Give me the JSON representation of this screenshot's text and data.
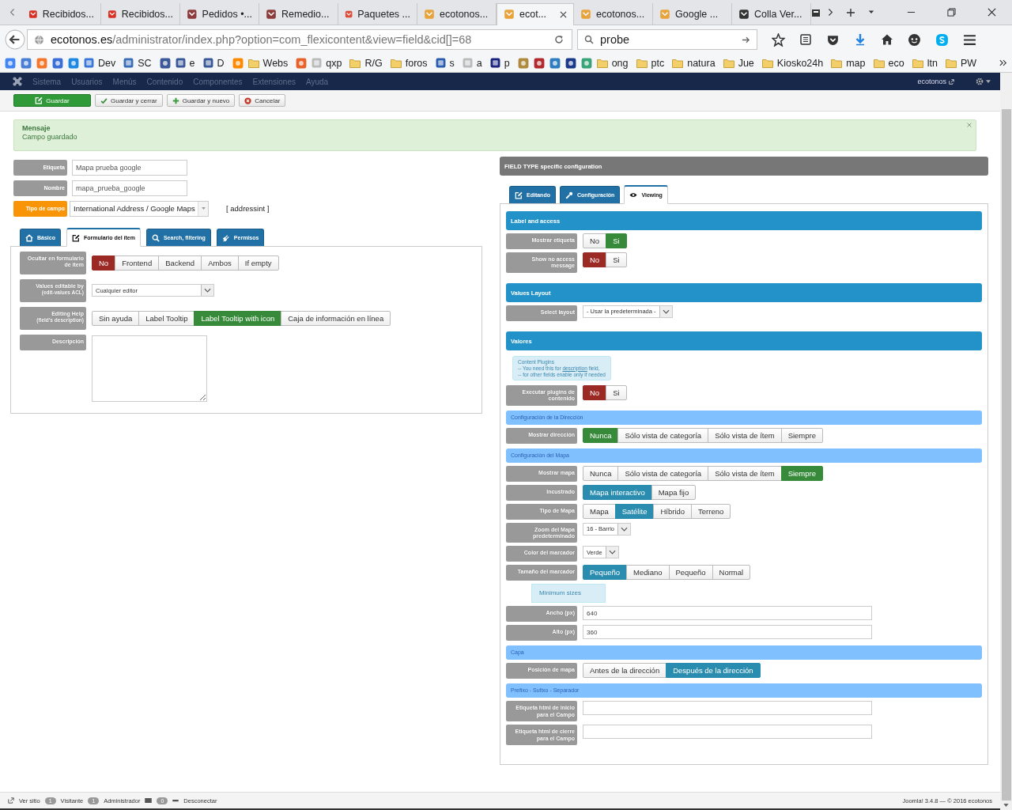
{
  "browser": {
    "tabs": [
      {
        "title": "Recibidos...",
        "selected": false
      },
      {
        "title": "Recibidos...",
        "selected": false
      },
      {
        "title": "Pedidos •...",
        "selected": false
      },
      {
        "title": "Remedio...",
        "selected": false
      },
      {
        "title": "Paquetes ...",
        "selected": false
      },
      {
        "title": "ecotonos...",
        "selected": false
      },
      {
        "title": "ecot...",
        "selected": true
      },
      {
        "title": "ecotonos...",
        "selected": false
      },
      {
        "title": "Google ...",
        "selected": false
      },
      {
        "title": "Colla Ver...",
        "selected": false
      }
    ],
    "url_host": "ecotonos.es",
    "url_path": "/administrator/index.php?option=com_flexicontent&view=field&cid[]=68",
    "search": "probe",
    "bookmarks": [
      {
        "kind": "icon"
      },
      {
        "kind": "icon"
      },
      {
        "kind": "icon"
      },
      {
        "kind": "icon"
      },
      {
        "kind": "icon"
      },
      {
        "kind": "site",
        "label": "Dev"
      },
      {
        "kind": "site",
        "label": "SC"
      },
      {
        "kind": "icon"
      },
      {
        "kind": "site",
        "label": "e"
      },
      {
        "kind": "site",
        "label": "D"
      },
      {
        "kind": "icon"
      },
      {
        "kind": "folder",
        "label": "Webs"
      },
      {
        "kind": "icon"
      },
      {
        "kind": "site",
        "label": "qxp"
      },
      {
        "kind": "folder",
        "label": "R/G"
      },
      {
        "kind": "folder",
        "label": "foros"
      },
      {
        "kind": "site",
        "label": "s"
      },
      {
        "kind": "site",
        "label": "a"
      },
      {
        "kind": "site",
        "label": "p"
      },
      {
        "kind": "icon"
      },
      {
        "kind": "icon"
      },
      {
        "kind": "icon"
      },
      {
        "kind": "icon"
      },
      {
        "kind": "icon"
      },
      {
        "kind": "folder",
        "label": "ong"
      },
      {
        "kind": "folder",
        "label": "ptc"
      },
      {
        "kind": "folder",
        "label": "natura"
      },
      {
        "kind": "folder",
        "label": "Jue"
      },
      {
        "kind": "folder",
        "label": "Kiosko24h"
      },
      {
        "kind": "folder",
        "label": "map"
      },
      {
        "kind": "folder",
        "label": "eco"
      },
      {
        "kind": "folder",
        "label": "ltn"
      },
      {
        "kind": "folder",
        "label": "PW"
      }
    ]
  },
  "admin_menu": {
    "items": [
      "Sistema",
      "Usuarios",
      "Menús",
      "Contenido",
      "Componentes",
      "Extensiones",
      "Ayuda"
    ],
    "user": "ecotonos"
  },
  "toolbar": [
    {
      "label": "Guardar",
      "kind": "primary"
    },
    {
      "label": "Guardar y cerrar",
      "kind": "default"
    },
    {
      "label": "Guardar y nuevo",
      "kind": "default"
    },
    {
      "label": "Cancelar",
      "kind": "default"
    }
  ],
  "message": {
    "title": "Mensaje",
    "text": "Campo guardado"
  },
  "left": {
    "fields": [
      {
        "label": "Etiqueta",
        "kind": "input",
        "value": "Mapa prueba google",
        "highlight": false
      },
      {
        "label": "Nombre",
        "kind": "input",
        "value": "mapa_prueba_google",
        "highlight": false
      },
      {
        "label": "Tipo de campo",
        "kind": "select",
        "value": "International Address / Google Maps",
        "note": "[ addressint ]",
        "highlight": true
      }
    ],
    "tabs": [
      {
        "label": "Básico",
        "selected": false
      },
      {
        "label": "Formulario del ítem",
        "selected": true
      },
      {
        "label": "Search, filtering",
        "selected": false
      },
      {
        "label": "Permisos",
        "selected": false
      }
    ],
    "rows": [
      {
        "label": "Ocultar en formulario de ítem",
        "kind": "toggle",
        "color": "#9b2a25",
        "options": [
          {
            "label": "No",
            "selected": true
          },
          {
            "label": "Frontend",
            "selected": false
          },
          {
            "label": "Backend",
            "selected": false
          },
          {
            "label": "Ambos",
            "selected": false
          },
          {
            "label": "If empty",
            "selected": false
          }
        ]
      },
      {
        "label": "Values editable by",
        "sub": "(edit-values ACL)",
        "kind": "select",
        "value": "Cualquier editor"
      },
      {
        "label": "Editing Help",
        "sub": "(field's description)",
        "kind": "toggle",
        "color": "#378a3a",
        "options": [
          {
            "label": "Sin ayuda",
            "selected": false
          },
          {
            "label": "Label Tooltip",
            "selected": false
          },
          {
            "label": "Label Tooltip with icon",
            "selected": true
          },
          {
            "label": "Caja de información en línea",
            "selected": false
          }
        ]
      },
      {
        "label": "Descripción",
        "kind": "textarea"
      }
    ]
  },
  "right": {
    "title": "FIELD TYPE specific configuration",
    "tabs": [
      {
        "label": "Editando",
        "selected": false
      },
      {
        "label": "Configuración",
        "selected": false
      },
      {
        "label": "Viewing",
        "selected": true
      }
    ],
    "sections": [
      {
        "title": "Label and access",
        "kind": "major",
        "rows": [
          {
            "label": "Mostrar etiqueta",
            "kind": "toggle",
            "color": "#378a3a",
            "options": [
              {
                "label": "No",
                "selected": false
              },
              {
                "label": "Si",
                "selected": true
              }
            ]
          },
          {
            "label": "Show no access message",
            "kind": "toggle",
            "color": "#9b2a25",
            "options": [
              {
                "label": "No",
                "selected": true
              },
              {
                "label": "Si",
                "selected": false
              }
            ]
          }
        ]
      },
      {
        "title": "Values Layout",
        "kind": "major",
        "rows": [
          {
            "label": "Select layout",
            "kind": "select",
            "value": "- Usar la predeterminada -"
          }
        ]
      },
      {
        "title": "Valores",
        "kind": "major",
        "rows": [
          {
            "kind": "plugin_note",
            "title": "Content Plugins",
            "line1": "-- You need this for ",
            "link": "description",
            "line1_end": " field,",
            "line2": "-- for other fields enable only if needed"
          },
          {
            "label": "Executar plugins de contenido",
            "kind": "toggle",
            "color": "#9b2a25",
            "options": [
              {
                "label": "No",
                "selected": true
              },
              {
                "label": "Si",
                "selected": false
              }
            ]
          }
        ]
      },
      {
        "title": "Configuración de la Dirección",
        "kind": "minor",
        "rows": [
          {
            "label": "Mostrar dirección",
            "kind": "toggle",
            "color": "#378a3a",
            "options": [
              {
                "label": "Nunca",
                "selected": true
              },
              {
                "label": "Sólo vista de categoría",
                "selected": false
              },
              {
                "label": "Sólo vista de ítem",
                "selected": false
              },
              {
                "label": "Siempre",
                "selected": false
              }
            ]
          }
        ]
      },
      {
        "title": "Configuración del Mapa",
        "kind": "minor",
        "rows": [
          {
            "label": "Mostrar mapa",
            "kind": "toggle",
            "color": "#378a3a",
            "options": [
              {
                "label": "Nunca",
                "selected": false
              },
              {
                "label": "Sólo vista de categoría",
                "selected": false
              },
              {
                "label": "Sólo vista de ítem",
                "selected": false
              },
              {
                "label": "Siempre",
                "selected": true
              }
            ]
          },
          {
            "label": "Incustrado",
            "kind": "toggle",
            "color": "#2a8db0",
            "options": [
              {
                "label": "Mapa interactivo",
                "selected": true
              },
              {
                "label": "Mapa fijo",
                "selected": false
              }
            ]
          },
          {
            "label": "Tipo de Mapa",
            "kind": "toggle",
            "color": "#2a8db0",
            "options": [
              {
                "label": "Mapa",
                "selected": false
              },
              {
                "label": "Satélite",
                "selected": true
              },
              {
                "label": "Híbrido",
                "selected": false
              },
              {
                "label": "Terreno",
                "selected": false
              }
            ]
          },
          {
            "label": "Zoom del Mapa predeterminado",
            "kind": "select",
            "value": "16 - Barrio"
          },
          {
            "label": "Color del marcador",
            "kind": "select",
            "value": "Verde"
          },
          {
            "label": "Tamaño del marcador",
            "kind": "toggle",
            "color": "#2a8db0",
            "options": [
              {
                "label": "Pequeño",
                "selected": true
              },
              {
                "label": "Mediano",
                "selected": false
              },
              {
                "label": "Pequeño",
                "selected": false
              },
              {
                "label": "Normal",
                "selected": false
              }
            ]
          },
          {
            "kind": "note",
            "text": "Minimum sizes"
          },
          {
            "label": "Ancho (px)",
            "kind": "input",
            "value": "640"
          },
          {
            "label": "Alto (px)",
            "kind": "input",
            "value": "360"
          }
        ]
      },
      {
        "title": "Capa",
        "kind": "minor",
        "rows": [
          {
            "label": "Posición de mapa",
            "kind": "toggle",
            "color": "#2a8db0",
            "options": [
              {
                "label": "Antes de la dirección",
                "selected": false
              },
              {
                "label": "Después de la dirección",
                "selected": true
              }
            ]
          }
        ]
      },
      {
        "title": "Prefixo - Sufixo - Separador",
        "kind": "minor",
        "rows": [
          {
            "label": "Etiqueta html de inicio para el Campo",
            "kind": "input"
          },
          {
            "label": "Etiqueta html de cierre para el Campo",
            "kind": "input"
          }
        ]
      }
    ]
  },
  "status_bar": {
    "view_site": "Ver sitio",
    "visitors": "1",
    "visitors_label": "Visitante",
    "admins": "1",
    "admins_label": "Administrador",
    "messages": "0",
    "logout": "Desconectar",
    "version": "Joomla! 3.4.8 — © 2016 ecotonos"
  }
}
